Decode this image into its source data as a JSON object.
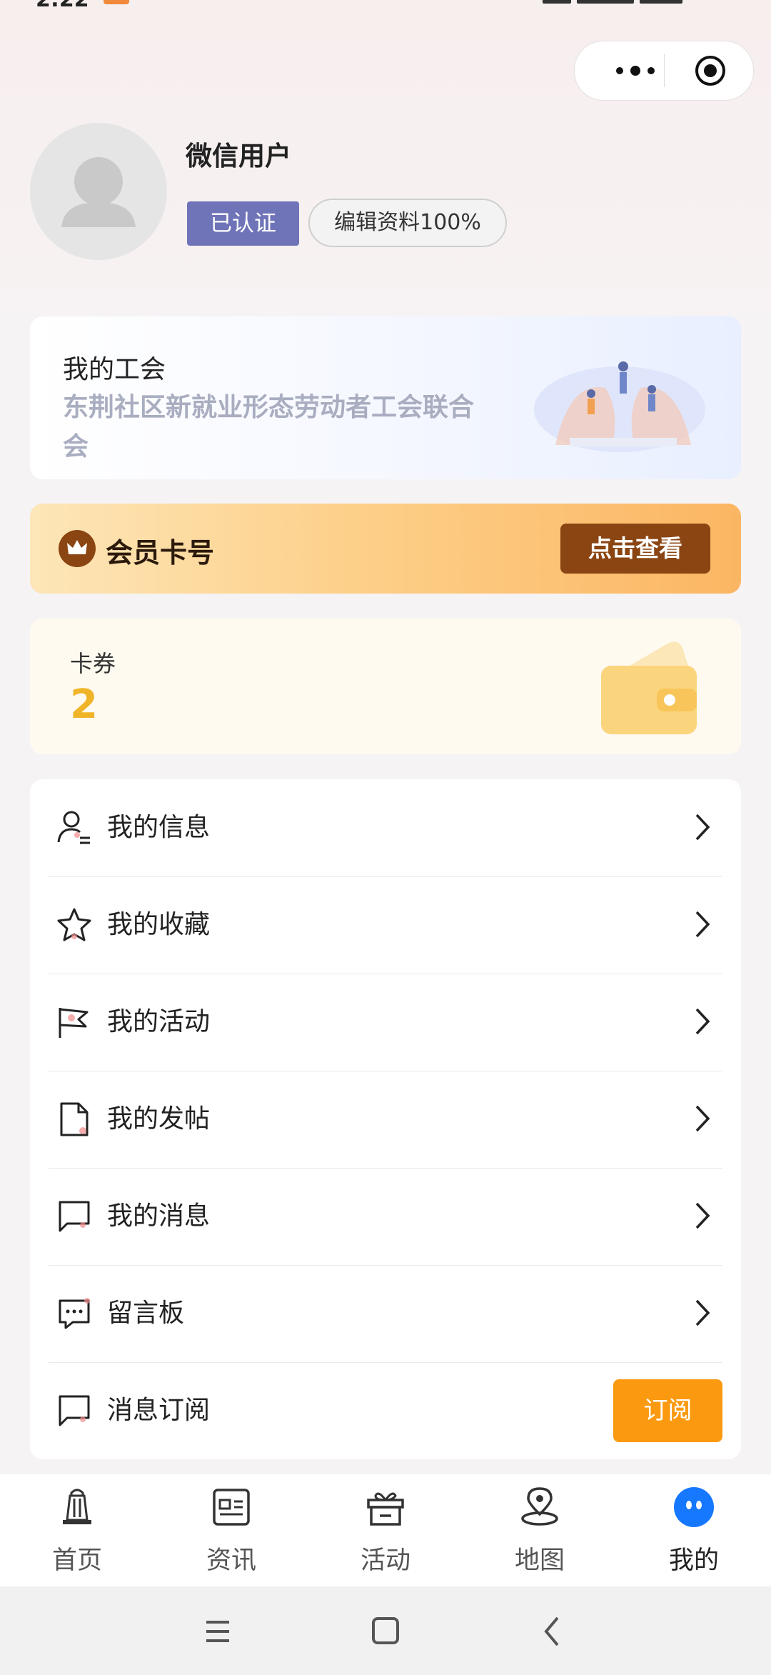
{
  "status": {
    "time": "2:22"
  },
  "capsule": {
    "more_icon": "more-dots-icon",
    "close_icon": "target-icon"
  },
  "profile": {
    "name": "微信用户",
    "verified_label": "已认证",
    "edit_label": "编辑资料100%"
  },
  "union": {
    "title": "我的工会",
    "name": "东荆社区新就业形态劳动者工会联合会"
  },
  "member": {
    "title": "会员卡号",
    "button": "点击查看"
  },
  "coupon": {
    "label": "卡券",
    "count": "2"
  },
  "menu": {
    "items": [
      {
        "label": "我的信息",
        "icon": "user-info-icon"
      },
      {
        "label": "我的收藏",
        "icon": "star-icon"
      },
      {
        "label": "我的活动",
        "icon": "flag-icon"
      },
      {
        "label": "我的发帖",
        "icon": "document-icon"
      },
      {
        "label": "我的消息",
        "icon": "message-icon"
      },
      {
        "label": "留言板",
        "icon": "chat-dots-icon"
      },
      {
        "label": "消息订阅",
        "icon": "message-icon",
        "button": "订阅"
      }
    ]
  },
  "tabs": [
    {
      "label": "首页",
      "icon": "tower-icon"
    },
    {
      "label": "资讯",
      "icon": "news-icon"
    },
    {
      "label": "活动",
      "icon": "gift-icon"
    },
    {
      "label": "地图",
      "icon": "map-pin-icon"
    },
    {
      "label": "我的",
      "icon": "profile-face-icon",
      "active": true
    }
  ],
  "colors": {
    "accent_orange": "#fb9a11",
    "verified_purple": "#6f74b8",
    "member_brown": "#8a4512",
    "coupon_yellow": "#f0b429",
    "active_tab_blue": "#1677ff"
  }
}
